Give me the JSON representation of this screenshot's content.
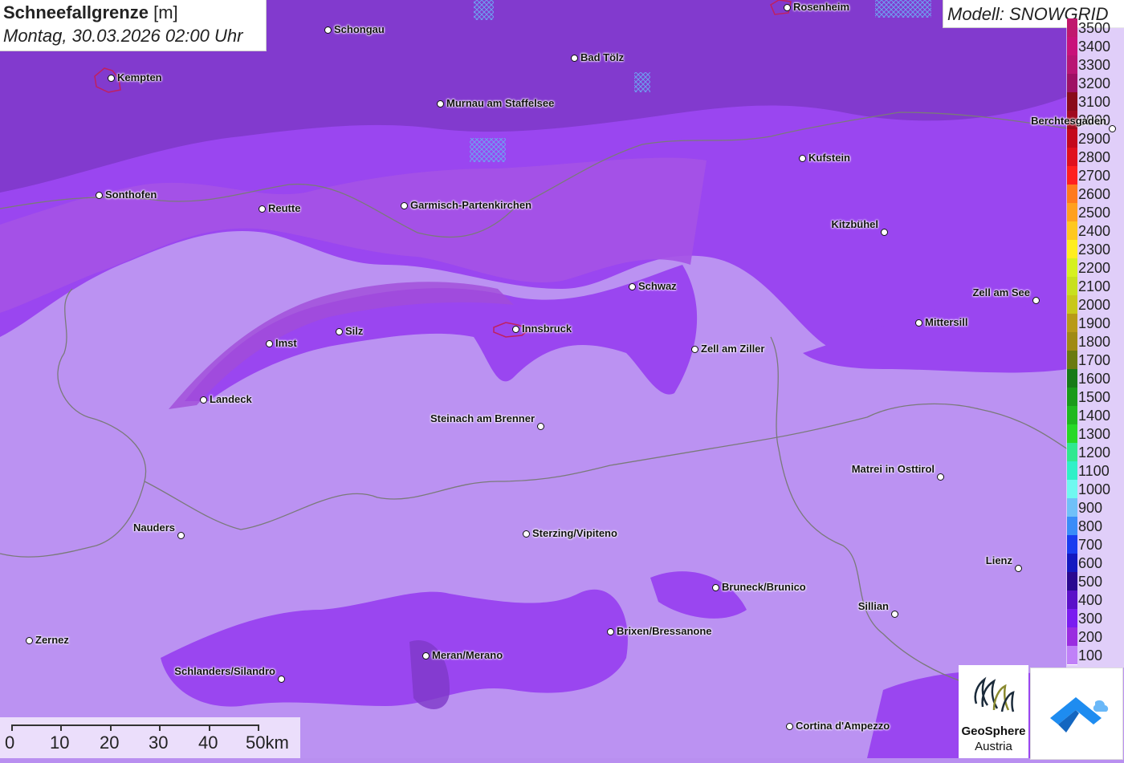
{
  "header": {
    "title_bold": "Schneefallgrenze",
    "title_unit": "[m]",
    "subtitle": "Montag, 30.03.2026 02:00 Uhr"
  },
  "model": {
    "label": "Modell: SNOWGRID"
  },
  "legend": {
    "items": [
      {
        "label": "3500",
        "color": "#c0186e"
      },
      {
        "label": "3400",
        "color": "#c8127a"
      },
      {
        "label": "3300",
        "color": "#b81573"
      },
      {
        "label": "3200",
        "color": "#9e1064"
      },
      {
        "label": "3100",
        "color": "#8a0a1a"
      },
      {
        "label": "3000",
        "color": "#a00a1e"
      },
      {
        "label": "2900",
        "color": "#c4081c"
      },
      {
        "label": "2800",
        "color": "#e0101e"
      },
      {
        "label": "2700",
        "color": "#ff2020"
      },
      {
        "label": "2600",
        "color": "#ff7a1e"
      },
      {
        "label": "2500",
        "color": "#ffa020"
      },
      {
        "label": "2400",
        "color": "#ffc820"
      },
      {
        "label": "2300",
        "color": "#ffee20"
      },
      {
        "label": "2200",
        "color": "#d6f020"
      },
      {
        "label": "2100",
        "color": "#c8e01e"
      },
      {
        "label": "2000",
        "color": "#c8c81a"
      },
      {
        "label": "1900",
        "color": "#b89a18"
      },
      {
        "label": "1800",
        "color": "#a08a14"
      },
      {
        "label": "1700",
        "color": "#6a7a10"
      },
      {
        "label": "1600",
        "color": "#187a18"
      },
      {
        "label": "1500",
        "color": "#1a9a1a"
      },
      {
        "label": "1400",
        "color": "#20b820"
      },
      {
        "label": "1300",
        "color": "#28d828"
      },
      {
        "label": "1200",
        "color": "#30e890"
      },
      {
        "label": "1100",
        "color": "#30f0c8"
      },
      {
        "label": "1000",
        "color": "#70f8f0"
      },
      {
        "label": "900",
        "color": "#70c0f8"
      },
      {
        "label": "800",
        "color": "#3a8cf8"
      },
      {
        "label": "700",
        "color": "#1a3cf0"
      },
      {
        "label": "600",
        "color": "#1418c0"
      },
      {
        "label": "500",
        "color": "#2a0890"
      },
      {
        "label": "400",
        "color": "#5a10c8"
      },
      {
        "label": "300",
        "color": "#7a1cf0"
      },
      {
        "label": "200",
        "color": "#9a2ce0"
      },
      {
        "label": "100",
        "color": "#c080f8"
      }
    ]
  },
  "cities": [
    {
      "name": "Rosenheim",
      "label_side": "right"
    },
    {
      "name": "Schongau",
      "label_side": "right"
    },
    {
      "name": "Kempten",
      "label_side": "right"
    },
    {
      "name": "Bad Tölz",
      "label_side": "right"
    },
    {
      "name": "Murnau am Staffelsee",
      "label_side": "right"
    },
    {
      "name": "Berchtesgaden",
      "label_side": "left"
    },
    {
      "name": "Kufstein",
      "label_side": "right"
    },
    {
      "name": "Sonthofen",
      "label_side": "right"
    },
    {
      "name": "Reutte",
      "label_side": "right"
    },
    {
      "name": "Garmisch-Partenkirchen",
      "label_side": "right"
    },
    {
      "name": "Kitzbühel",
      "label_side": "left"
    },
    {
      "name": "Schwaz",
      "label_side": "right"
    },
    {
      "name": "Zell am See",
      "label_side": "left"
    },
    {
      "name": "Mittersill",
      "label_side": "right"
    },
    {
      "name": "Silz",
      "label_side": "right"
    },
    {
      "name": "Innsbruck",
      "label_side": "right"
    },
    {
      "name": "Imst",
      "label_side": "right"
    },
    {
      "name": "Zell am Ziller",
      "label_side": "right"
    },
    {
      "name": "Landeck",
      "label_side": "right"
    },
    {
      "name": "Steinach am Brenner",
      "label_side": "left"
    },
    {
      "name": "Matrei in Osttirol",
      "label_side": "left"
    },
    {
      "name": "Nauders",
      "label_side": "left"
    },
    {
      "name": "Sterzing/Vipiteno",
      "label_side": "right"
    },
    {
      "name": "Lienz",
      "label_side": "left"
    },
    {
      "name": "Bruneck/Brunico",
      "label_side": "right"
    },
    {
      "name": "Sillian",
      "label_side": "left"
    },
    {
      "name": "Brixen/Bressanone",
      "label_side": "right"
    },
    {
      "name": "Zernez",
      "label_side": "right"
    },
    {
      "name": "Meran/Merano",
      "label_side": "right"
    },
    {
      "name": "Schlanders/Silandro",
      "label_side": "left"
    },
    {
      "name": "Cortina d'Ampezzo",
      "label_side": "right"
    }
  ],
  "scale_bar": {
    "labels": [
      "0",
      "10",
      "20",
      "30",
      "40",
      "50km"
    ]
  },
  "logos": {
    "geosphere_name": "GeoSphere",
    "geosphere_sub": "Austria"
  }
}
